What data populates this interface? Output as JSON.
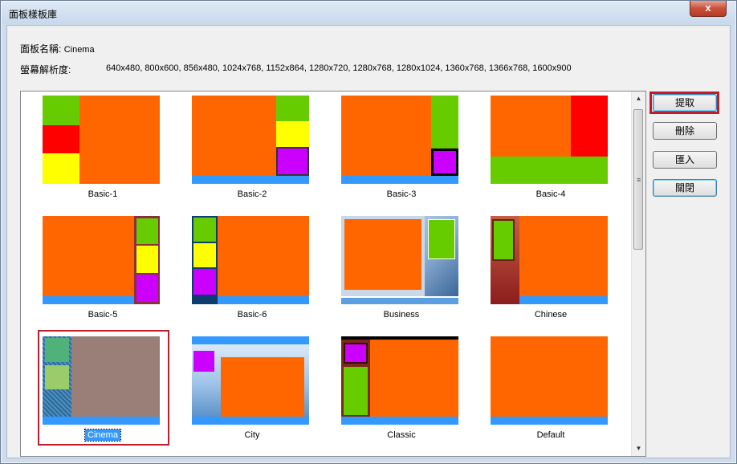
{
  "window": {
    "title": "面板樣板庫",
    "close_glyph": "x"
  },
  "info": {
    "name_label": "面板名稱:",
    "name_value": "Cinema",
    "resolution_label": "螢幕解析度:",
    "resolution_values": "640x480, 800x600, 856x480, 1024x768, 1152x864, 1280x720, 1280x768, 1280x1024, 1360x768, 1366x768, 1600x900"
  },
  "templates": [
    {
      "name": "Basic-1"
    },
    {
      "name": "Basic-2"
    },
    {
      "name": "Basic-3"
    },
    {
      "name": "Basic-4"
    },
    {
      "name": "Basic-5"
    },
    {
      "name": "Basic-6"
    },
    {
      "name": "Business"
    },
    {
      "name": "Chinese"
    },
    {
      "name": "Cinema",
      "selected": true
    },
    {
      "name": "City"
    },
    {
      "name": "Classic"
    },
    {
      "name": "Default"
    }
  ],
  "buttons": {
    "extract": "提取",
    "delete": "刪除",
    "import": "匯入",
    "close": "關閉"
  },
  "colors": {
    "selection_highlight": "#c01c2a",
    "orange": "#ff6600",
    "green": "#66cc00",
    "red": "#ff0000",
    "yellow": "#ffff00",
    "purple": "#cc00ff",
    "blue": "#3399ff"
  }
}
